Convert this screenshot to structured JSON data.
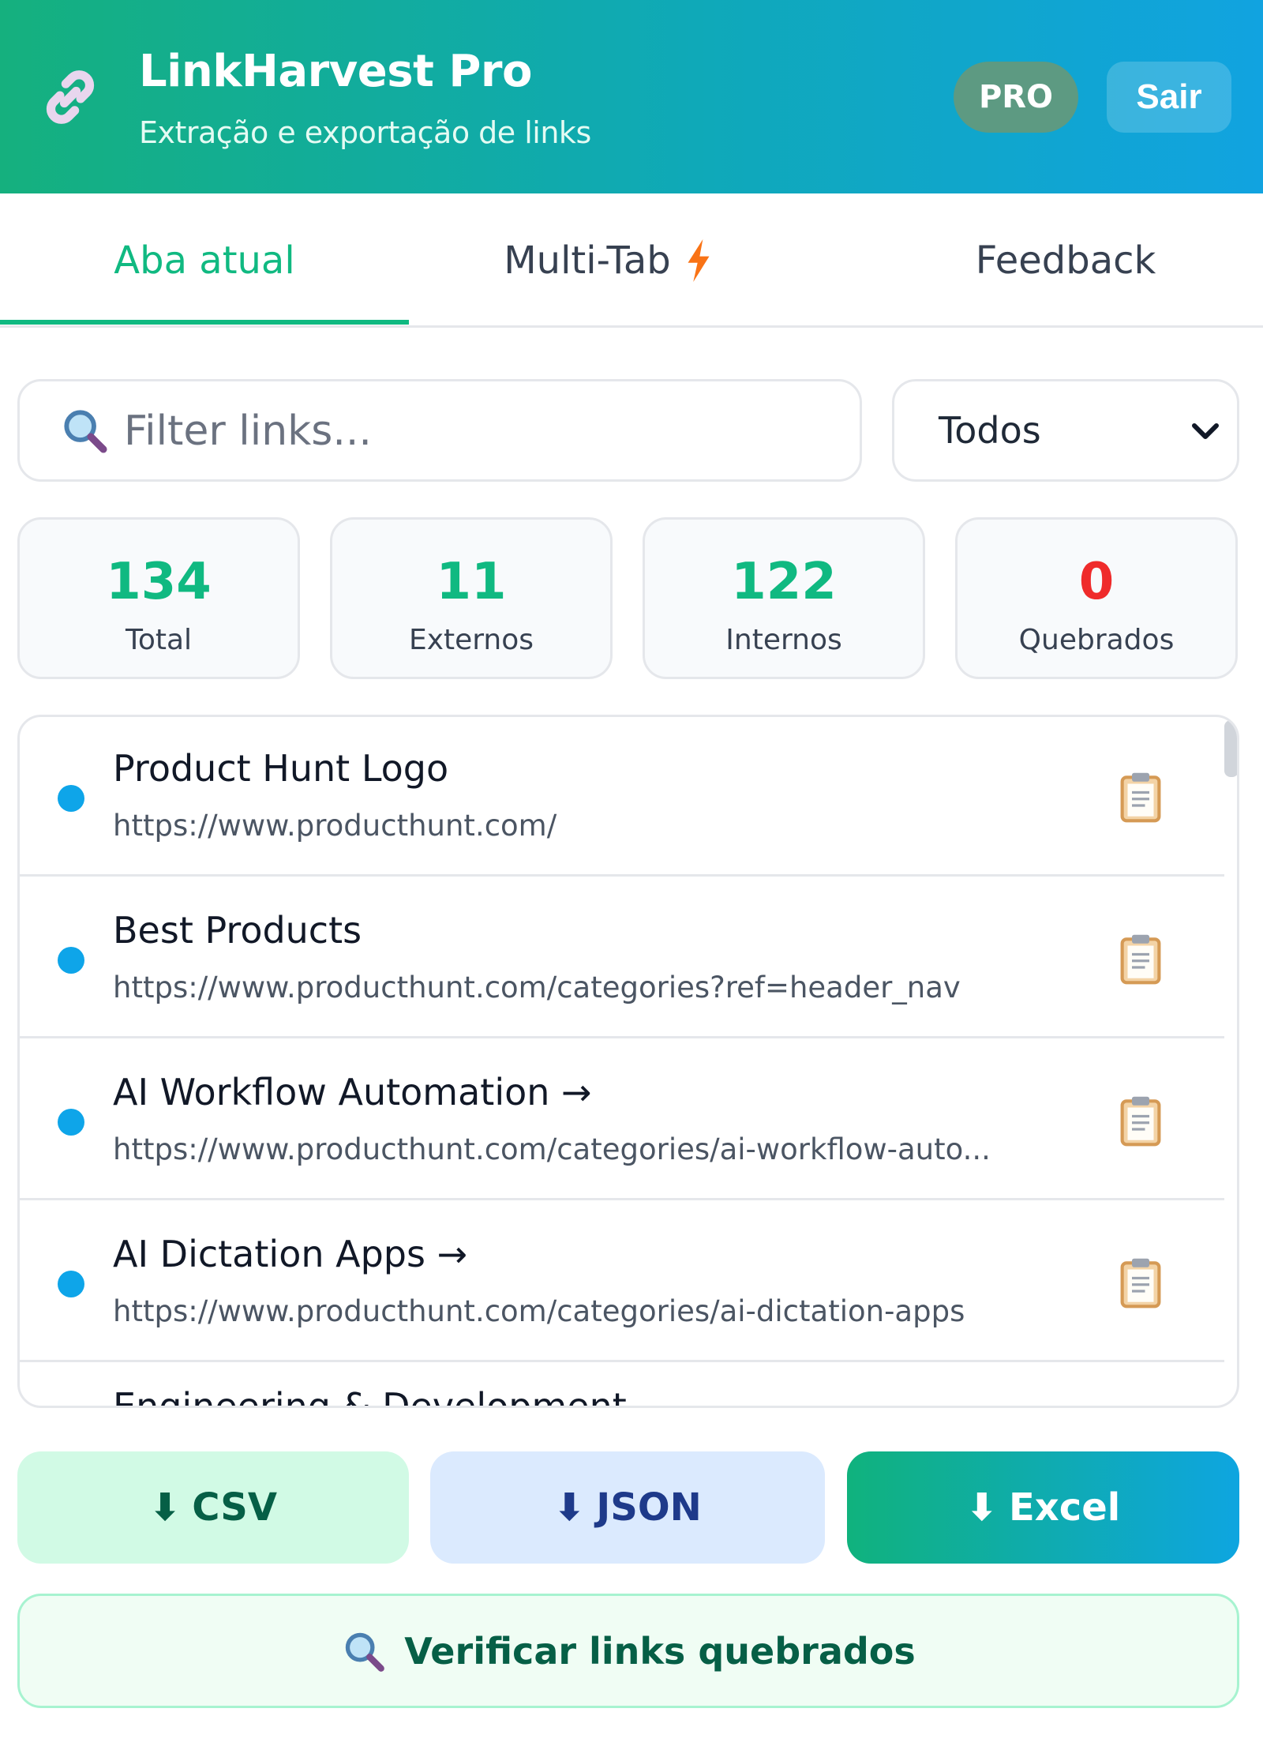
{
  "header": {
    "title": "LinkHarvest Pro",
    "subtitle": "Extração e exportação de links",
    "badge": "PRO",
    "logout_label": "Sair",
    "icon": "link-icon"
  },
  "tabs": [
    {
      "label": "Aba atual",
      "active": true
    },
    {
      "label": "Multi-Tab",
      "active": false,
      "icon": "lightning-icon"
    },
    {
      "label": "Feedback",
      "active": false
    }
  ],
  "filter": {
    "placeholder": "Filter links...",
    "select_value": "Todos"
  },
  "stats": [
    {
      "value": "134",
      "label": "Total"
    },
    {
      "value": "11",
      "label": "Externos"
    },
    {
      "value": "122",
      "label": "Internos"
    },
    {
      "value": "0",
      "label": "Quebrados"
    }
  ],
  "links": [
    {
      "title": "Product Hunt Logo",
      "url": "https://www.producthunt.com/"
    },
    {
      "title": "Best Products",
      "url": "https://www.producthunt.com/categories?ref=header_nav"
    },
    {
      "title": "AI Workflow Automation →",
      "url": "https://www.producthunt.com/categories/ai-workflow-auto..."
    },
    {
      "title": "AI Dictation Apps →",
      "url": "https://www.producthunt.com/categories/ai-dictation-apps"
    }
  ],
  "partial_link_title": "Engineering & Development",
  "export": {
    "csv": "CSV",
    "json": "JSON",
    "excel": "Excel",
    "download_glyph": "⬇"
  },
  "check_button_label": "Verificar links quebrados",
  "colors": {
    "accent": "#10b981",
    "link_dot": "#0ea5e9",
    "broken": "#ef2b2b"
  }
}
